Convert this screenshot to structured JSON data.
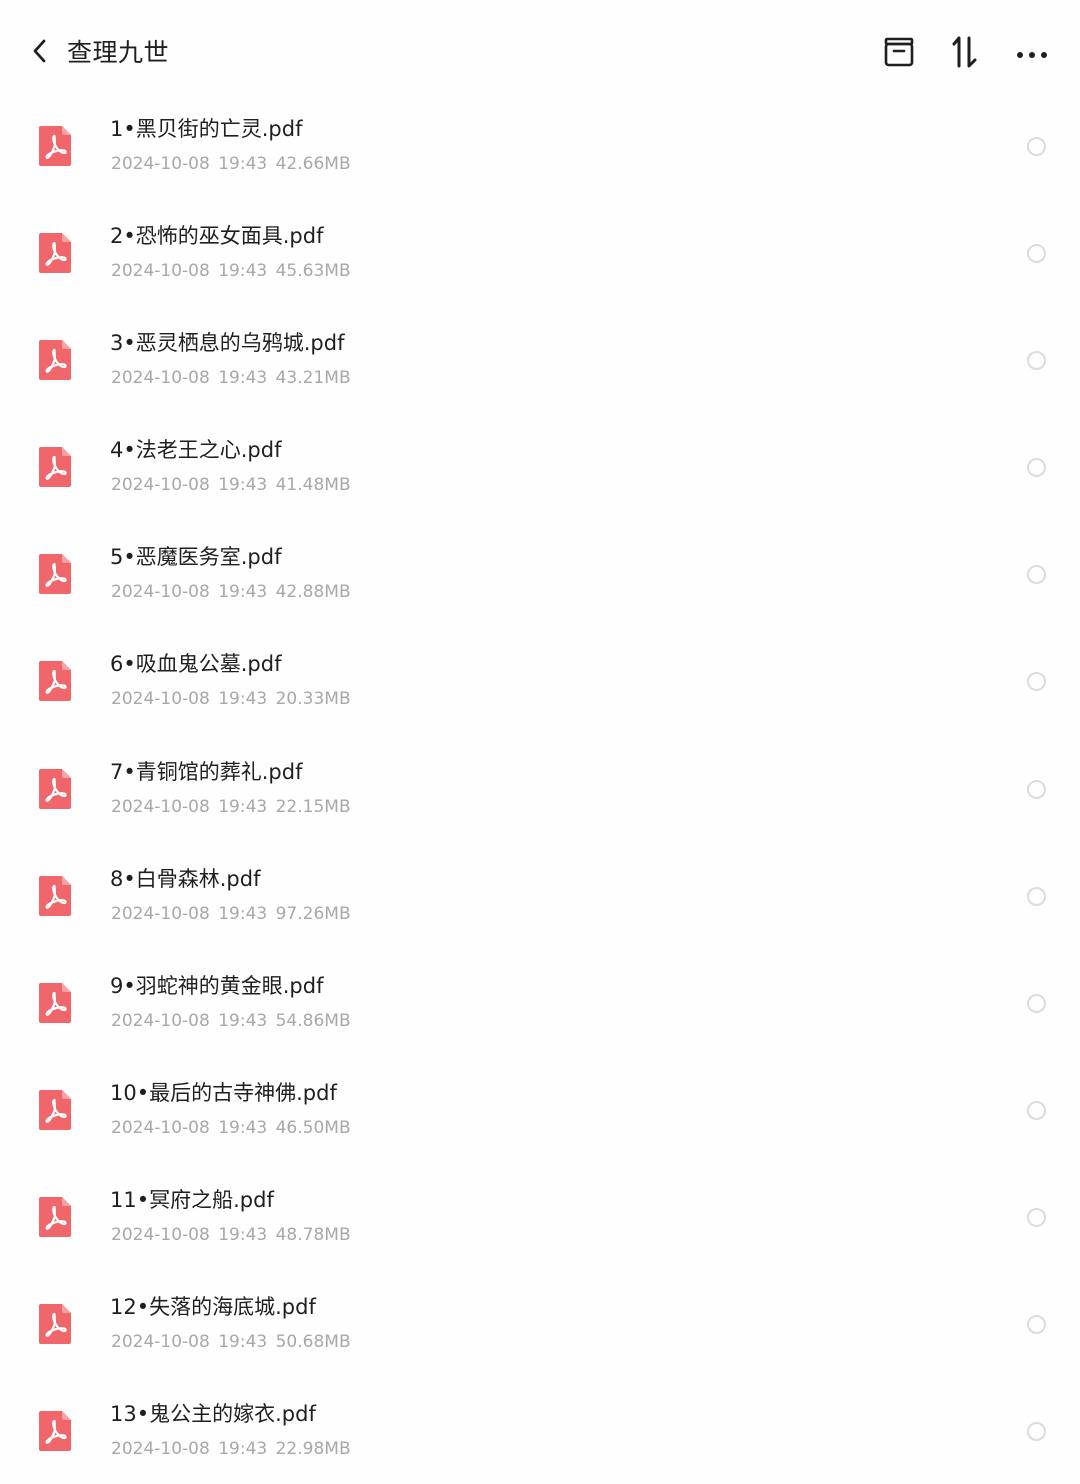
{
  "header": {
    "title": "查理九世",
    "back_icon": "chevron-left-icon",
    "actions": [
      "archive-icon",
      "sort-icon",
      "more-icon"
    ]
  },
  "colors": {
    "pdf_icon": "#f0666b",
    "meta_text": "#a8a8a8",
    "radio_border": "#dcdcdc"
  },
  "files": [
    {
      "name": "1•黑贝街的亡灵.pdf",
      "date": "2024-10-08",
      "time": "19:43",
      "size": "42.66MB"
    },
    {
      "name": "2•恐怖的巫女面具.pdf",
      "date": "2024-10-08",
      "time": "19:43",
      "size": "45.63MB"
    },
    {
      "name": "3•恶灵栖息的乌鸦城.pdf",
      "date": "2024-10-08",
      "time": "19:43",
      "size": "43.21MB"
    },
    {
      "name": "4•法老王之心.pdf",
      "date": "2024-10-08",
      "time": "19:43",
      "size": "41.48MB"
    },
    {
      "name": "5•恶魔医务室.pdf",
      "date": "2024-10-08",
      "time": "19:43",
      "size": "42.88MB"
    },
    {
      "name": "6•吸血鬼公墓.pdf",
      "date": "2024-10-08",
      "time": "19:43",
      "size": "20.33MB"
    },
    {
      "name": "7•青铜馆的葬礼.pdf",
      "date": "2024-10-08",
      "time": "19:43",
      "size": "22.15MB"
    },
    {
      "name": "8•白骨森林.pdf",
      "date": "2024-10-08",
      "time": "19:43",
      "size": "97.26MB"
    },
    {
      "name": "9•羽蛇神的黄金眼.pdf",
      "date": "2024-10-08",
      "time": "19:43",
      "size": "54.86MB"
    },
    {
      "name": "10•最后的古寺神佛.pdf",
      "date": "2024-10-08",
      "time": "19:43",
      "size": "46.50MB"
    },
    {
      "name": "11•冥府之船.pdf",
      "date": "2024-10-08",
      "time": "19:43",
      "size": "48.78MB"
    },
    {
      "name": "12•失落的海底城.pdf",
      "date": "2024-10-08",
      "time": "19:43",
      "size": "50.68MB"
    },
    {
      "name": "13•鬼公主的嫁衣.pdf",
      "date": "2024-10-08",
      "time": "19:43",
      "size": "22.98MB"
    }
  ]
}
